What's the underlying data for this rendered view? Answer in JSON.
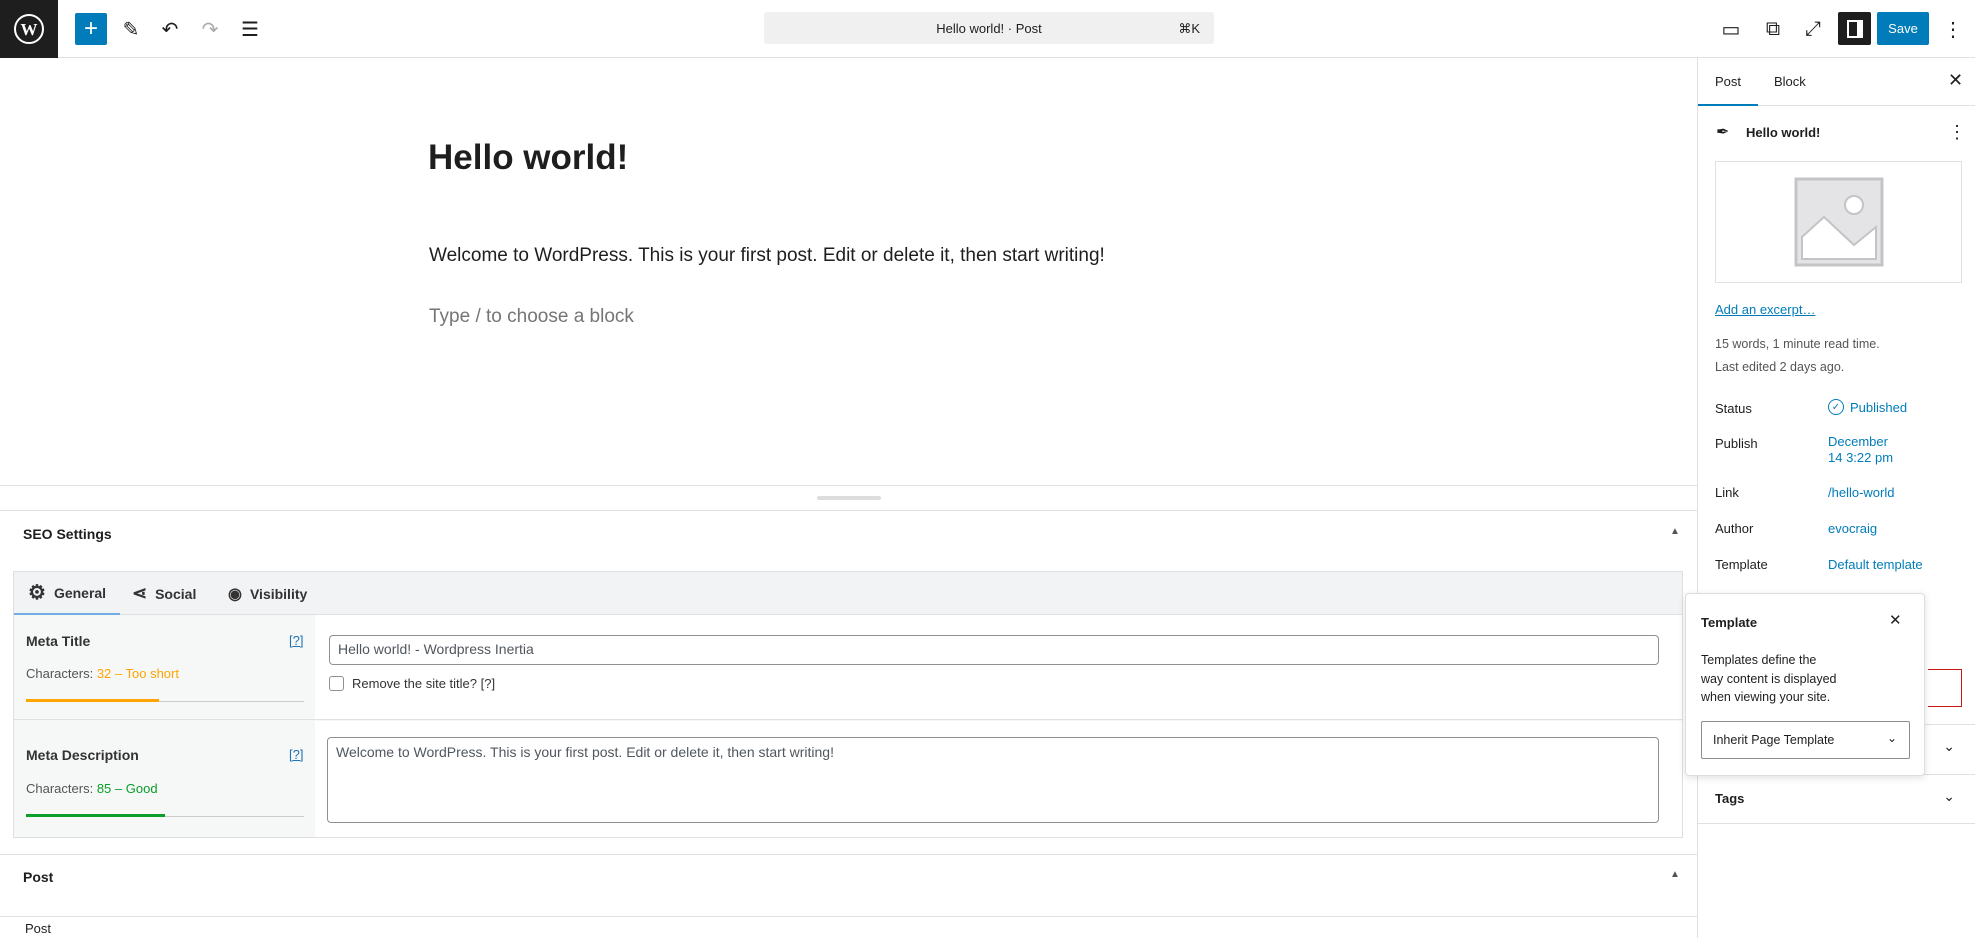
{
  "topbar": {
    "document_title": "Hello world! · Post",
    "shortcut": "⌘K",
    "save_label": "Save",
    "icons": [
      "wordpress-logo",
      "plus",
      "pencil",
      "undo",
      "redo",
      "list-view",
      "desktop-preview",
      "external-link",
      "fullscreen",
      "sidebar-toggle",
      "more-vertical"
    ]
  },
  "editor": {
    "post_title": "Hello world!",
    "paragraph": "Welcome to WordPress. This is your first post. Edit or delete it, then start writing!",
    "placeholder": "Type / to choose a block"
  },
  "seo": {
    "header": "SEO Settings",
    "tabs": [
      {
        "label": "General",
        "icon": "gear"
      },
      {
        "label": "Social",
        "icon": "share"
      },
      {
        "label": "Visibility",
        "icon": "eye"
      }
    ],
    "meta_title": {
      "label": "Meta Title",
      "help": "[?]",
      "chars_label": "Characters:",
      "chars_status": "32 – Too short",
      "status_color": "#ffa500",
      "progress": 0.48,
      "value": "Hello world! - Wordpress Inertia",
      "checkbox_label": "Remove the site title? [?]"
    },
    "meta_description": {
      "label": "Meta Description",
      "help": "[?]",
      "chars_label": "Characters:",
      "chars_status": "85 – Good",
      "status_color": "#0a9e2a",
      "progress": 0.5,
      "value": "Welcome to WordPress. This is your first post. Edit or delete it, then start writing!"
    }
  },
  "post_panel": {
    "header": "Post"
  },
  "statusbar": {
    "breadcrumb": "Post"
  },
  "sidebar": {
    "tabs": [
      "Post",
      "Block"
    ],
    "post_title": "Hello world!",
    "excerpt_link": "Add an excerpt…",
    "stats": "15 words, 1 minute read time.",
    "last_edited": "Last edited 2 days ago.",
    "rows": [
      {
        "label": "Status",
        "value": "Published"
      },
      {
        "label": "Publish",
        "value": "December 14 3:22 pm"
      },
      {
        "label": "Link",
        "value": "/hello-world"
      },
      {
        "label": "Author",
        "value": "evocraig"
      },
      {
        "label": "Template",
        "value": "Default template"
      }
    ],
    "tags_label": "Tags"
  },
  "popover": {
    "title": "Template",
    "description": "Templates define the way content is displayed when viewing your site.",
    "select_value": "Inherit Page Template"
  },
  "colors": {
    "accent": "#007cba",
    "dark": "#1e1e1e"
  }
}
